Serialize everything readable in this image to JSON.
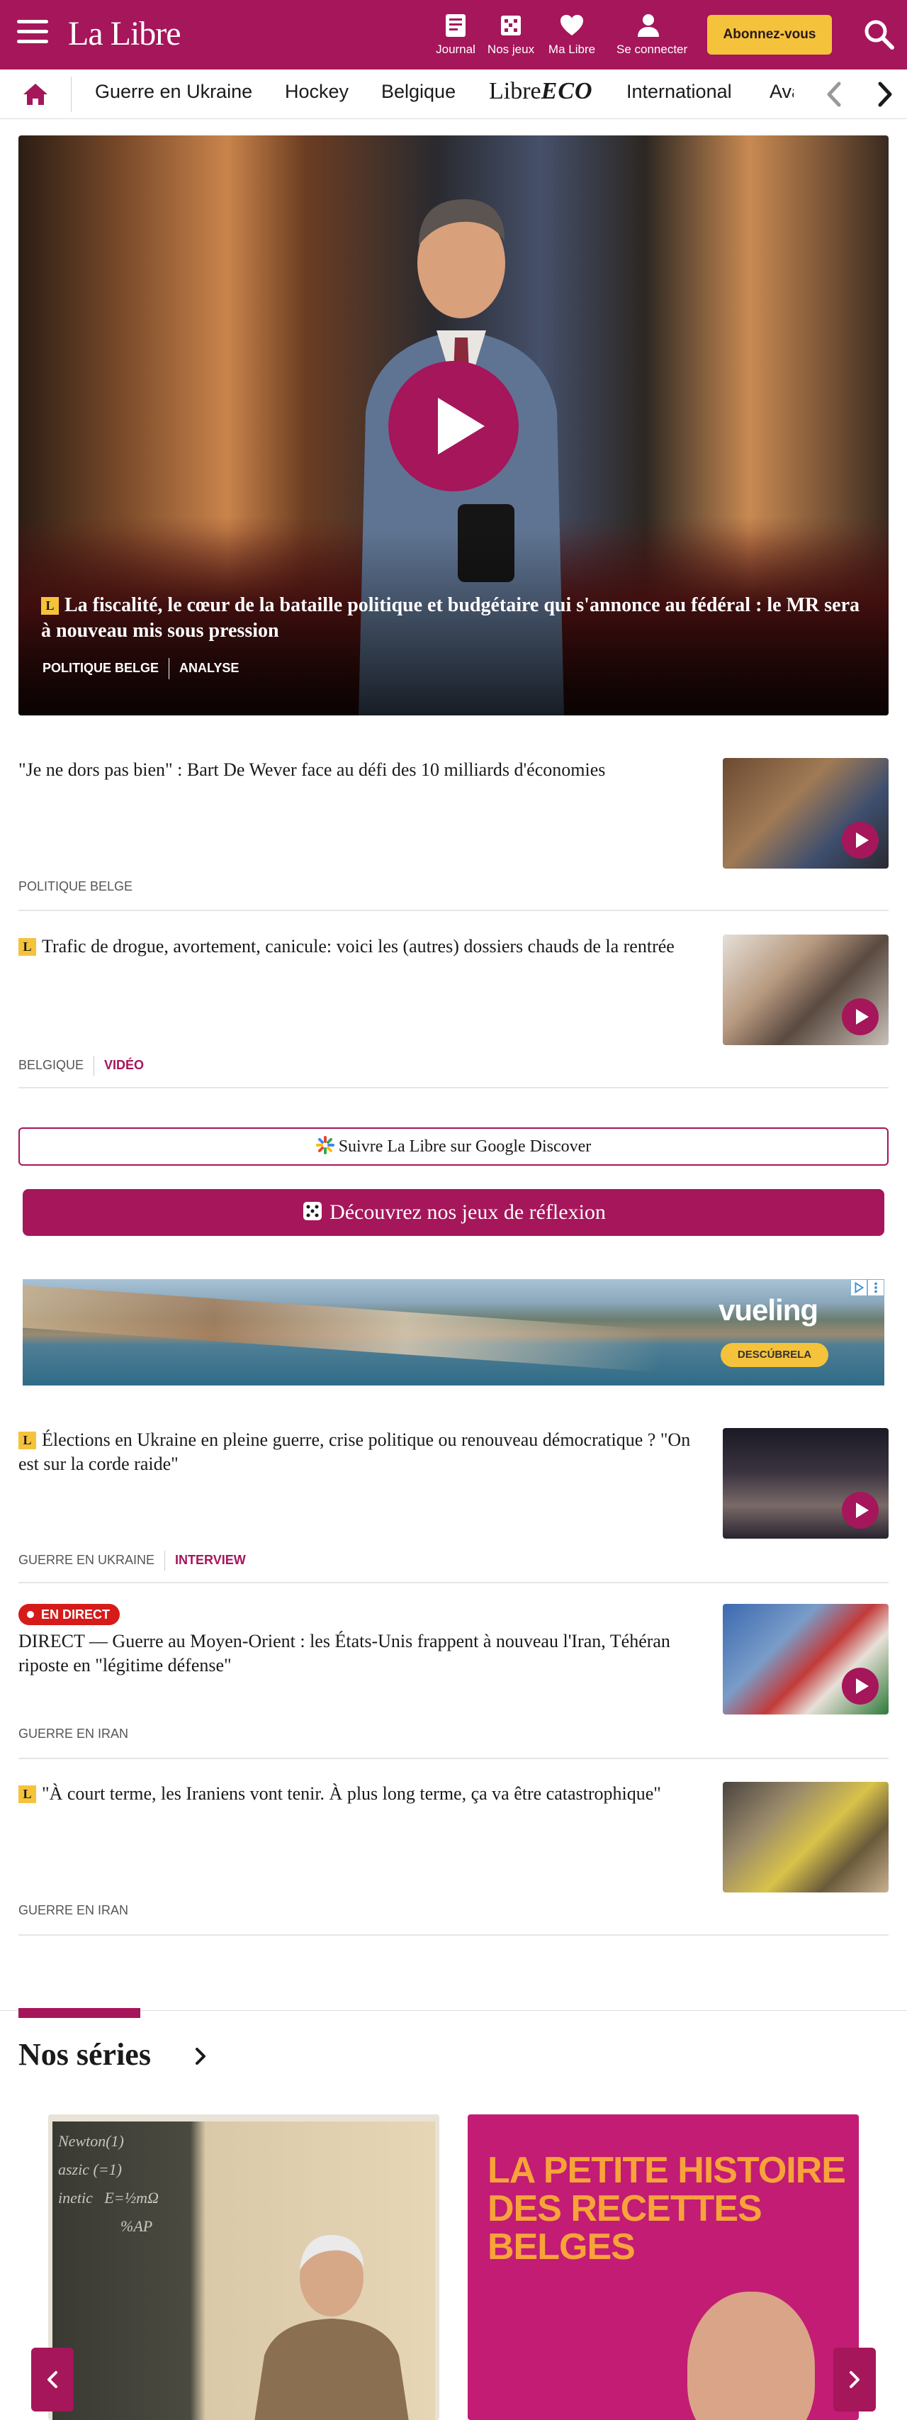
{
  "header": {
    "logo": "La Libre",
    "icons": [
      {
        "name": "journal-icon",
        "label": "Journal"
      },
      {
        "name": "games-icon",
        "label": "Nos jeux"
      },
      {
        "name": "heart-icon",
        "label": "Ma Libre"
      },
      {
        "name": "user-icon",
        "label": "Se connecter"
      }
    ],
    "subscribe_label": "Abonnez-vous"
  },
  "nav": {
    "items": [
      "Guerre en Ukraine",
      "Hockey",
      "Belgique",
      "International",
      "Avan"
    ],
    "eco_prefix": "Libre",
    "eco_suffix": "ECO"
  },
  "hero": {
    "badge": "L",
    "title": "La fiscalité, le cœur de la bataille politique et budgétaire qui s'annonce au fédéral : le MR sera à nouveau mis sous pression",
    "tags": [
      "POLITIQUE BELGE",
      "ANALYSE"
    ]
  },
  "articles": [
    {
      "badge": "",
      "title": "\"Je ne dors pas bien\" : Bart De Wever face au défi des 10 milliards d'économies",
      "tags": [
        "POLITIQUE BELGE"
      ],
      "accent": "",
      "video": true
    },
    {
      "badge": "L",
      "title": "Trafic de drogue, avortement, canicule: voici les (autres) dossiers chauds de la rentrée",
      "tags": [
        "BELGIQUE"
      ],
      "accent": "VIDÉO",
      "video": true
    },
    {
      "badge": "L",
      "title": "Élections en Ukraine en pleine guerre, crise politique ou renouveau démocratique ? \"On est sur la corde raide\"",
      "tags": [
        "GUERRE EN UKRAINE"
      ],
      "accent": "INTERVIEW",
      "video": true
    },
    {
      "badge": "",
      "live": "EN DIRECT",
      "title": "DIRECT — Guerre au Moyen-Orient : les États-Unis frappent à nouveau l'Iran, Téhéran riposte en \"légitime défense\"",
      "tags": [
        "GUERRE EN IRAN"
      ],
      "accent": "",
      "video": true
    },
    {
      "badge": "L",
      "title": "\"À court terme, les Iraniens vont tenir. À plus long terme, ça va être catastrophique\"",
      "tags": [
        "GUERRE EN IRAN"
      ],
      "accent": "",
      "video": false
    }
  ],
  "google_discover": "Suivre La Libre sur Google Discover",
  "games_button": "Découvrez nos jeux de réflexion",
  "ad": {
    "brand": "vueling",
    "cta": "DESCÚBRELA"
  },
  "series": {
    "title": "Nos séries",
    "card1_chalk": [
      "Newton(1)",
      "aszic (=1)",
      "inetic   E=½mΩ",
      "                %AP"
    ],
    "card2_text": "LA PETITE HISTOIRE DES RECETTES BELGES"
  },
  "colors": {
    "brand": "#a5165a",
    "accent": "#f5c33b",
    "live": "#d61b1b"
  }
}
